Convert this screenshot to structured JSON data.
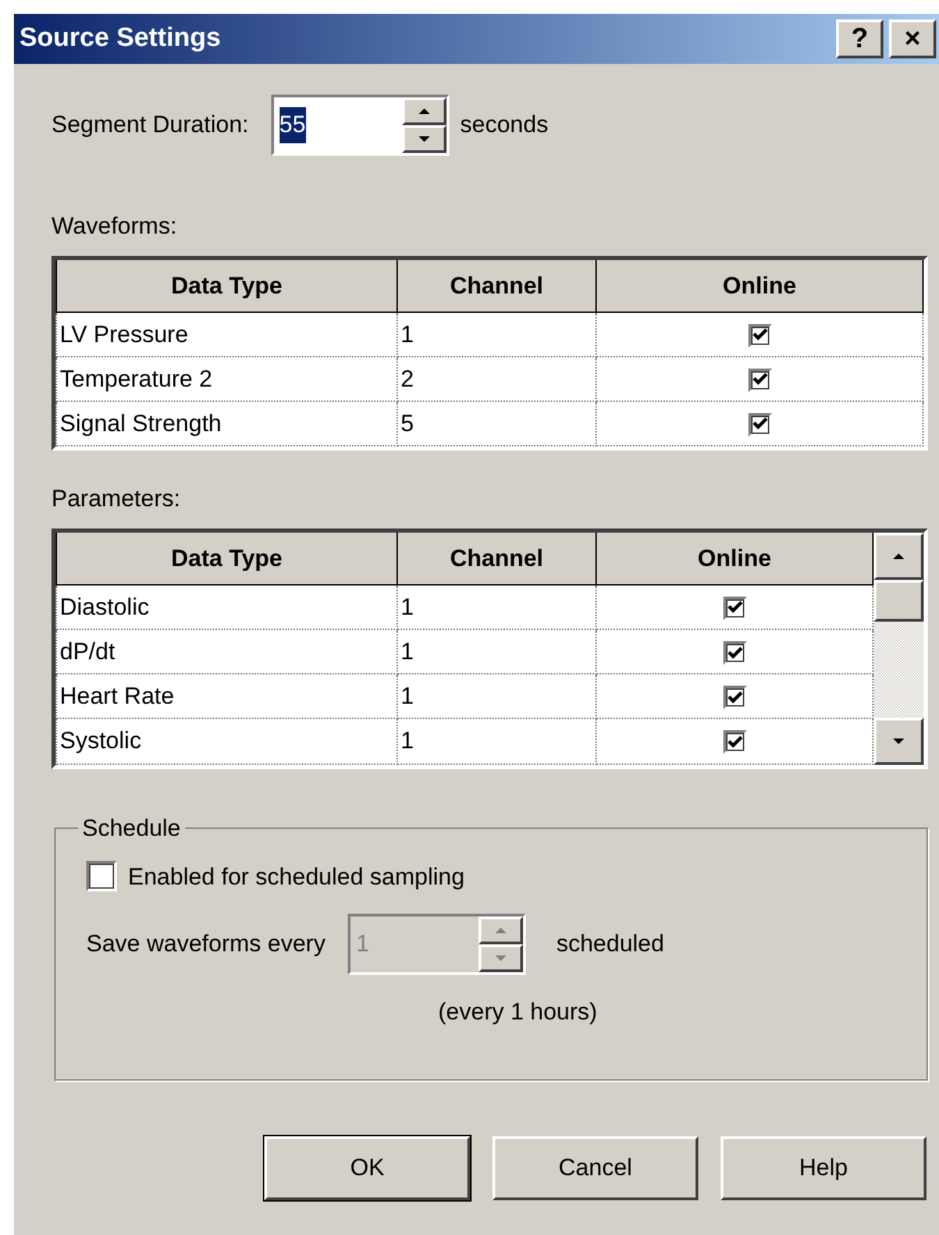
{
  "window": {
    "title": "Source Settings",
    "buttons": [
      "?",
      "×"
    ]
  },
  "segment_duration": {
    "label": "Segment Duration:",
    "value": "55",
    "selected": true,
    "unit": "seconds"
  },
  "waveforms": {
    "label": "Waveforms:",
    "columns": [
      "Data Type",
      "Channel",
      "Online"
    ],
    "rows": [
      {
        "data_type": "LV Pressure",
        "channel": "1",
        "online": true
      },
      {
        "data_type": "Temperature 2",
        "channel": "2",
        "online": true
      },
      {
        "data_type": "Signal Strength",
        "channel": "5",
        "online": true
      }
    ]
  },
  "parameters": {
    "label": "Parameters:",
    "columns": [
      "Data Type",
      "Channel",
      "Online"
    ],
    "rows": [
      {
        "data_type": "Diastolic",
        "channel": "1",
        "online": true
      },
      {
        "data_type": "dP/dt",
        "channel": "1",
        "online": true
      },
      {
        "data_type": "Heart Rate",
        "channel": "1",
        "online": true
      },
      {
        "data_type": "Systolic",
        "channel": "1",
        "online": true
      }
    ]
  },
  "schedule": {
    "title": "Schedule",
    "checkbox": {
      "label": "Enabled for scheduled sampling",
      "checked": false
    },
    "save_label": "Save waveforms every",
    "save_value": "1",
    "disabled": true,
    "save_unit": "scheduled",
    "note": "(every 1 hours)"
  },
  "buttons": [
    {
      "label": "OK",
      "default": true
    },
    {
      "label": "Cancel",
      "default": false
    },
    {
      "label": "Help",
      "default": false
    }
  ]
}
